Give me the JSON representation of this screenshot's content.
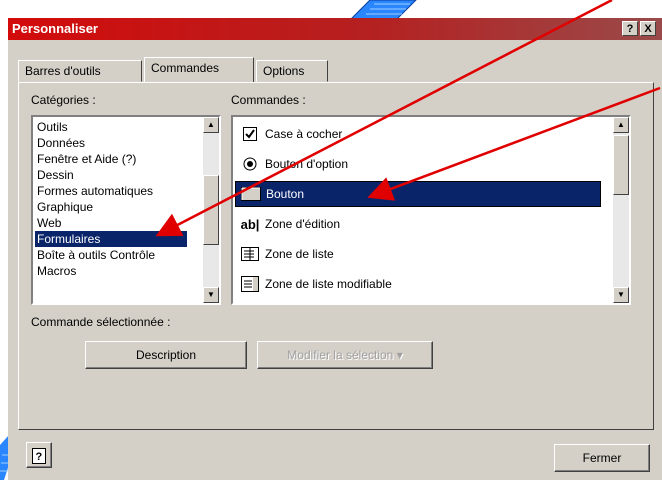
{
  "window": {
    "title": "Personnaliser",
    "help_button": "?",
    "close_button": "X"
  },
  "tabs": [
    {
      "label": "Barres d'outils"
    },
    {
      "label": "Commandes"
    },
    {
      "label": "Options"
    }
  ],
  "categories": {
    "label": "Catégories :",
    "items": [
      "Outils",
      "Données",
      "Fenêtre et Aide (?)",
      "Dessin",
      "Formes automatiques",
      "Graphique",
      "Web",
      "Formulaires",
      "Boîte à outils Contrôle",
      "Macros"
    ],
    "selected": "Formulaires"
  },
  "commands": {
    "label": "Commandes :",
    "items": [
      {
        "label": "Case à cocher",
        "icon": "checkbox-icon"
      },
      {
        "label": "Bouton d'option",
        "icon": "radio-button-icon"
      },
      {
        "label": "Bouton",
        "icon": "button-icon"
      },
      {
        "label": "Zone d'édition",
        "icon": "edit-box-icon",
        "icon_text": "ab|"
      },
      {
        "label": "Zone de liste",
        "icon": "list-box-icon"
      },
      {
        "label": "Zone de liste modifiable",
        "icon": "combo-box-icon"
      }
    ],
    "selected": "Bouton"
  },
  "selected_command": {
    "label": "Commande sélectionnée :",
    "description_button": "Description",
    "modify_button": "Modifier la sélection"
  },
  "footer": {
    "close_button": "Fermer"
  },
  "colors": {
    "title_bar": "#d30b0b",
    "selection": "#0a246a",
    "annotation_arrow": "#e00000",
    "decor_blue": "#1e78ff"
  }
}
